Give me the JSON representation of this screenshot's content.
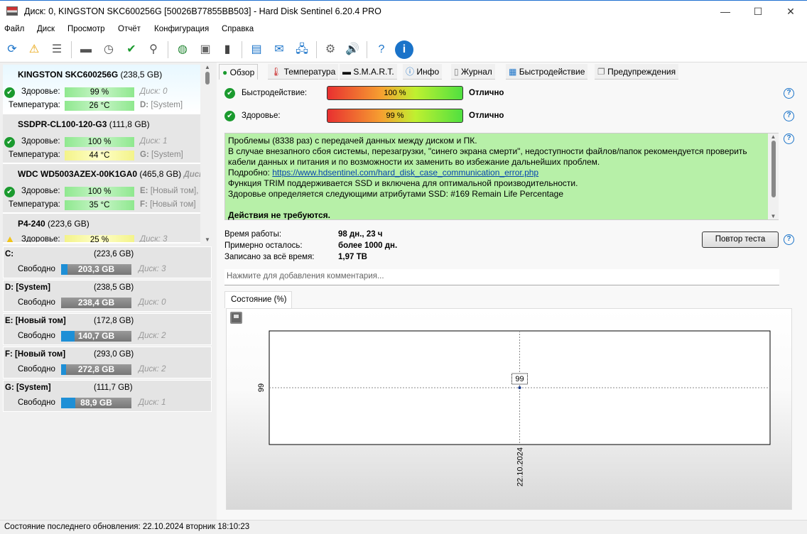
{
  "window": {
    "title": "Диск: 0, KINGSTON SKC600256G [50026B77855BB503]  -  Hard Disk Sentinel 6.20.4 PRO",
    "minimize": "—",
    "maximize": "☐",
    "close": "✕"
  },
  "menu": [
    "Файл",
    "Диск",
    "Просмотр",
    "Отчёт",
    "Конфигурация",
    "Справка"
  ],
  "toolbar": [
    "refresh-icon",
    "refresh-warning-icon",
    "disk-list-icon",
    "disk-sound-icon",
    "disk-clock-icon",
    "disk-check-icon",
    "disk-search-icon",
    "globe-disk-icon",
    "usb-icon",
    "usb-drive-icon",
    "notepad-icon",
    "mail-icon",
    "network-icon",
    "gear-icon",
    "speaker-icon",
    "help-icon",
    "info-icon"
  ],
  "disks": [
    {
      "name": "KINGSTON SKC600256G",
      "size": "(238,5 GB)",
      "health_label": "Здоровье:",
      "health": "99 %",
      "health_pct": 99,
      "temp_label": "Температура:",
      "temp": "26 °C",
      "disk": "Диск: 0",
      "vol1_letter": "D:",
      "vol1": "[System]",
      "status": "ok"
    },
    {
      "name": "SSDPR-CL100-120-G3",
      "size": "(111,8 GB)",
      "health_label": "Здоровье:",
      "health": "100 %",
      "health_pct": 100,
      "temp_label": "Температура:",
      "temp": "44 °C",
      "disk": "Диск: 1",
      "vol1_letter": "G:",
      "vol1": "[System]",
      "status": "ok"
    },
    {
      "name": "WDC WD5003AZEX-00K1GA0",
      "size": "(465,8 GB)",
      "extra": "Диск:",
      "health_label": "Здоровье:",
      "health": "100 %",
      "health_pct": 100,
      "temp_label": "Температура:",
      "temp": "35 °C",
      "vol0_letter": "E:",
      "vol0": "[Новый том],",
      "vol1_letter": "F:",
      "vol1": "[Новый том]",
      "status": "ok"
    },
    {
      "name": "P4-240",
      "size": "(223,6 GB)",
      "health_label": "Здоровье:",
      "health": "25 %",
      "health_pct": 25,
      "disk": "Диск: 3",
      "status": "warning"
    }
  ],
  "volumes": [
    {
      "name": "C:",
      "size": "(223,6 GB)",
      "free_label": "Свободно",
      "free": "203,3 GB",
      "used_pct": 9,
      "disk": "Диск: 3"
    },
    {
      "name": "D: [System]",
      "size": "(238,5 GB)",
      "free_label": "Свободно",
      "free": "238,4 GB",
      "used_pct": 0,
      "disk": "Диск: 0"
    },
    {
      "name": "E: [Новый том]",
      "size": "(172,8 GB)",
      "free_label": "Свободно",
      "free": "140,7 GB",
      "used_pct": 19,
      "disk": "Диск: 2"
    },
    {
      "name": "F: [Новый том]",
      "size": "(293,0 GB)",
      "free_label": "Свободно",
      "free": "272,8 GB",
      "used_pct": 7,
      "disk": "Диск: 2"
    },
    {
      "name": "G: [System]",
      "size": "(111,7 GB)",
      "free_label": "Свободно",
      "free": "88,9 GB",
      "used_pct": 20,
      "disk": "Диск: 1"
    }
  ],
  "tabs": [
    "Обзор",
    "Температура",
    "S.M.A.R.T.",
    "Инфо",
    "Журнал",
    "Быстродействие",
    "Предупреждения"
  ],
  "overview": {
    "perf_label": "Быстродействие:",
    "perf_value": "100 %",
    "perf_pct": 100,
    "perf_rating": "Отлично",
    "health_label": "Здоровье:",
    "health_value": "99 %",
    "health_pct": 99,
    "health_rating": "Отлично",
    "message": {
      "l1": "Проблемы (8338 раз) с передачей данных между диском и ПК.",
      "l2": "В случае внезапного сбоя системы, перезагрузки, \"синего экрана смерти\", недоступности файлов/папок рекомендуется проверить кабели данных и питания и по возможности их заменить во избежание дальнейших проблем.",
      "l3_prefix": "Подробно: ",
      "link": "https://www.hdsentinel.com/hard_disk_case_communication_error.php",
      "l4": "Функция TRIM поддерживается SSD и включена для оптимальной производительности.",
      "l5": "Здоровье определяется следующими атрибутами SSD: #169 Remain Life Percentage",
      "l6": "Действия не требуются."
    },
    "uptime_label": "Время работы:",
    "uptime": "98 дн., 23 ч",
    "remaining_label": "Примерно осталось:",
    "remaining": "более 1000 дн.",
    "written_label": "Записано за всё время:",
    "written": "1,97 TB",
    "retest": "Повтор теста",
    "comment_placeholder": "Нажмите для добавления комментария...",
    "chart_tab": "Состояние (%)"
  },
  "chart_data": {
    "type": "line",
    "x": [
      "22.10.2024"
    ],
    "values": [
      99
    ],
    "y_tick": "99",
    "point_label": "99",
    "grid": true
  },
  "colors": {
    "accent": "#1a73c9",
    "ok": "#1a9a2e",
    "message_bg": "#b7f0a8"
  },
  "status": "Состояние последнего обновления: 22.10.2024 вторник 18:10:23"
}
